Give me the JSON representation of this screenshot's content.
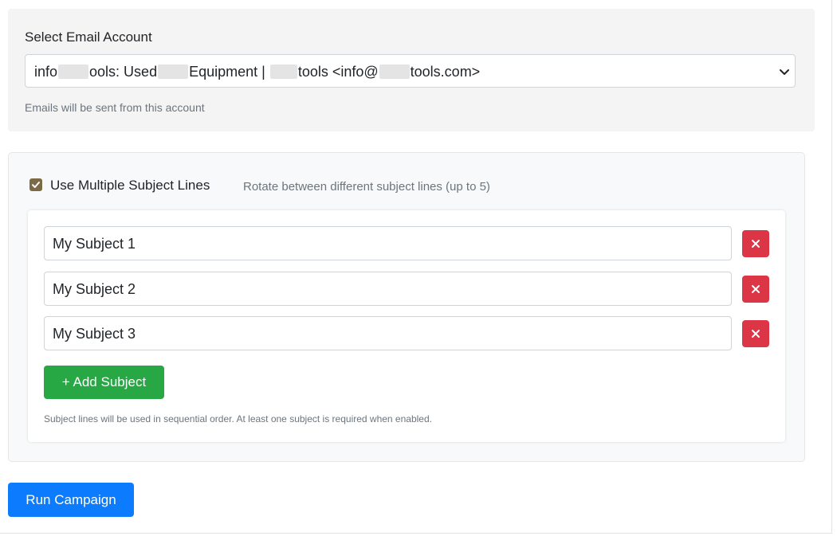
{
  "account": {
    "label": "Select Email Account",
    "selected": {
      "part1": "info",
      "part2": "ools: Used",
      "part3": "Equipment |",
      "part4": "tools <info@",
      "part5": "tools.com>"
    },
    "help": "Emails will be sent from this account"
  },
  "subjects": {
    "toggle_label": "Use Multiple Subject Lines",
    "toggle_checked": true,
    "toggle_help": "Rotate between different subject lines (up to 5)",
    "items": [
      {
        "value": "My Subject 1"
      },
      {
        "value": "My Subject 2"
      },
      {
        "value": "My Subject 3"
      }
    ],
    "add_label": "+ Add Subject",
    "help": "Subject lines will be used in sequential order. At least one subject is required when enabled."
  },
  "actions": {
    "run_label": "Run Campaign"
  },
  "colors": {
    "run_button": "#0d7bfd",
    "add_button": "#28a745",
    "remove_button": "#dc3545",
    "checkbox": "#7c6a46"
  },
  "icons": {
    "select_arrow": "chevron-down-icon",
    "remove": "close-icon",
    "checkbox": "check-icon"
  }
}
